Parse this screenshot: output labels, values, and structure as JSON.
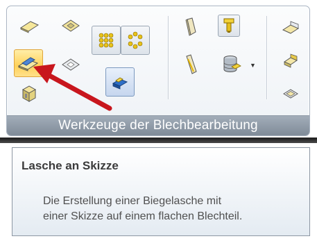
{
  "ribbon": {
    "group_label": "Werkzeuge der Blechbearbeitung",
    "buttons": [
      {
        "icon": "flat-plate-icon"
      },
      {
        "icon": "sheet-feature-icon"
      },
      {
        "icon": "tab-with-sketch-icon",
        "state": "active"
      },
      {
        "icon": "cutout-icon"
      },
      {
        "icon": "box-part-icon"
      },
      {
        "icon": "dot-pattern-icon"
      },
      {
        "icon": "circular-pattern-icon"
      },
      {
        "icon": "unfold-icon"
      },
      {
        "icon": "bend-icon"
      },
      {
        "icon": "edge-flange-icon"
      },
      {
        "icon": "tool-punch-icon"
      },
      {
        "icon": "material-database-icon"
      },
      {
        "icon": "plate-blue-icon"
      },
      {
        "icon": "form-feature-icon"
      },
      {
        "icon": "corner-feature-icon"
      }
    ]
  },
  "tooltip": {
    "title": "Lasche an Skizze",
    "line1": "Die Erstellung einer Biegelasche mit",
    "line2": "einer Skizze auf einem flachen Blechteil."
  },
  "colors": {
    "accent_active": "#ffd25a",
    "pointer_arrow": "#c8161d",
    "group_label_bg": "#8b97a4"
  }
}
